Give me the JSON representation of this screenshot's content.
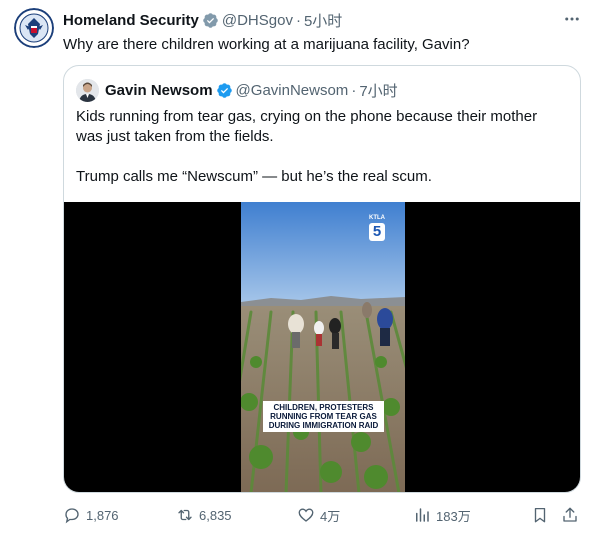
{
  "tweet": {
    "author_name": "Homeland Security",
    "author_handle": "@DHSgov",
    "separator": "·",
    "time": "5小时",
    "text": "Why are there children working at a marijuana facility, Gavin?"
  },
  "quoted": {
    "author_name": "Gavin Newsom",
    "author_handle": "@GavinNewsom",
    "separator": "·",
    "time": "7小时",
    "text_line1": "Kids running from tear gas, crying on the phone because their mother",
    "text_line2": "was just taken from the fields.",
    "text_line3": "Trump calls me “Newscum” — but he’s the real scum.",
    "video": {
      "caption_line1": "CHILDREN, PROTESTERS",
      "caption_line2": "RUNNING FROM TEAR GAS",
      "caption_line3": "DURING IMMIGRATION RAID",
      "station_top": "KTLA",
      "station_number": "5"
    }
  },
  "actions": {
    "replies": "1,876",
    "reposts": "6,835",
    "likes": "4万",
    "views": "183万"
  },
  "colors": {
    "verified_badge": "#1d9bf0",
    "secondary_text": "#536471",
    "border": "#cfd9de"
  }
}
